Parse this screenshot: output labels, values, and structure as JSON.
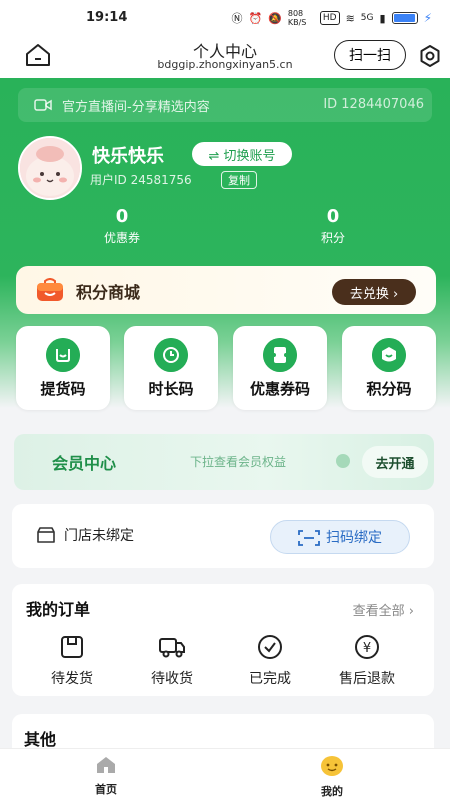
{
  "status_bar": {
    "time": "19:14",
    "net_speed": "808 KB/S",
    "hd": "HD",
    "signal": "5G",
    "battery": "100"
  },
  "header": {
    "title": "个人中心",
    "subtitle": "bdggip.zhongxinyan5.cn",
    "scan_label": "扫一扫"
  },
  "live_banner": {
    "text": "官方直播间-分享精选内容",
    "id": "ID 1284407046"
  },
  "user": {
    "name": "快乐快乐",
    "switch_label": "⇌ 切换账号",
    "user_id": "用户ID 24581756",
    "copy_label": "复制"
  },
  "stats": [
    {
      "value": "0",
      "label": "优惠券"
    },
    {
      "value": "0",
      "label": "积分"
    }
  ],
  "points_mall": {
    "title": "积分商城",
    "button": "去兑换 ›"
  },
  "tiles": [
    {
      "label": "提货码",
      "icon": "pickup-code-icon"
    },
    {
      "label": "时长码",
      "icon": "clock-icon"
    },
    {
      "label": "优惠券码",
      "icon": "coupon-icon"
    },
    {
      "label": "积分码",
      "icon": "points-icon"
    }
  ],
  "member": {
    "title": "会员中心",
    "hint": "下拉查看会员权益",
    "button": "去开通"
  },
  "store": {
    "text": "门店未绑定",
    "button": "扫码绑定"
  },
  "orders": {
    "title": "我的订单",
    "view_all": "查看全部 ›",
    "items": [
      {
        "label": "待发货",
        "icon": "package-icon"
      },
      {
        "label": "待收货",
        "icon": "truck-icon"
      },
      {
        "label": "已完成",
        "icon": "check-circle-icon"
      },
      {
        "label": "售后退款",
        "icon": "yuan-circle-icon"
      }
    ]
  },
  "others": {
    "title": "其他"
  },
  "bottom_nav": [
    {
      "label": "首页",
      "icon": "home-icon"
    },
    {
      "label": "我的",
      "icon": "profile-smile-icon"
    }
  ],
  "colors": {
    "primary_green": "#29b259",
    "exchange_brown": "#4a2f1c",
    "bind_blue": "#2a6cc4"
  }
}
